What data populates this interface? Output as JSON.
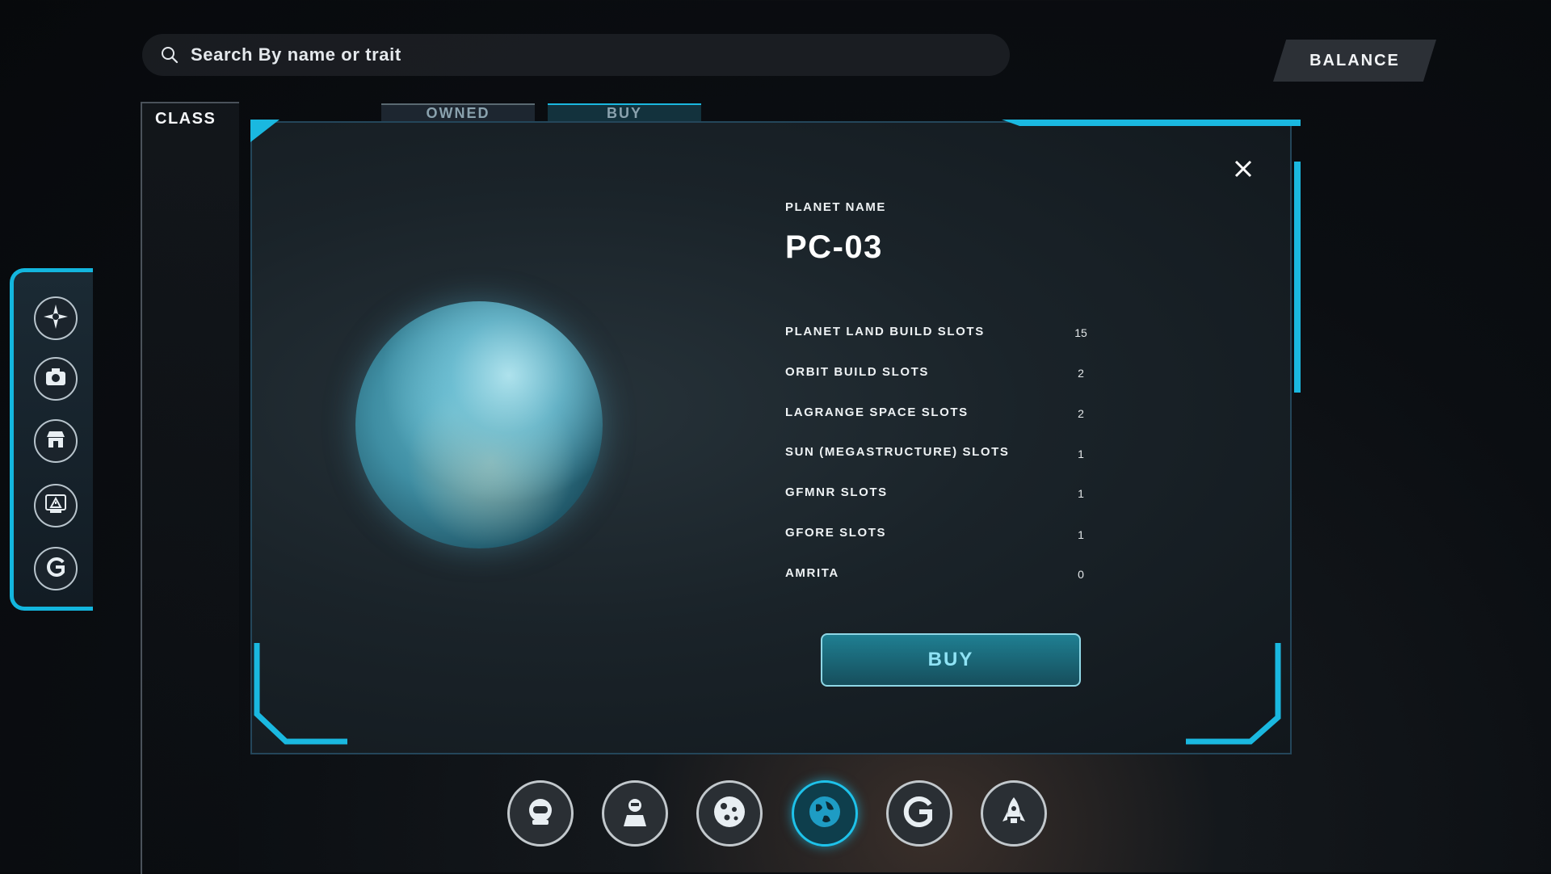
{
  "search": {
    "placeholder": "Search By name or trait",
    "icon": "search-icon"
  },
  "header": {
    "balance_label": "BALANCE"
  },
  "class_panel": {
    "label": "CLASS"
  },
  "tabs": [
    {
      "label": "OWNED",
      "active": false
    },
    {
      "label": "BUY",
      "active": true
    }
  ],
  "left_rail": {
    "items": [
      {
        "icon": "compass-icon"
      },
      {
        "icon": "camera-icon"
      },
      {
        "icon": "market-icon"
      },
      {
        "icon": "warning-icon"
      },
      {
        "icon": "g-logo-icon"
      }
    ]
  },
  "modal": {
    "close_icon": "close-icon",
    "planet_name_label": "PLANET NAME",
    "planet_name": "PC-03",
    "stats": [
      {
        "name": "PLANET LAND BUILD SLOTS",
        "value": "15"
      },
      {
        "name": "ORBIT BUILD SLOTS",
        "value": "2"
      },
      {
        "name": "LAGRANGE SPACE SLOTS",
        "value": "2"
      },
      {
        "name": "SUN (MEGASTRUCTURE) SLOTS",
        "value": "1"
      },
      {
        "name": "GFMNR SLOTS",
        "value": "1"
      },
      {
        "name": "GFORE SLOTS",
        "value": "1"
      },
      {
        "name": "AMRITA",
        "value": "0"
      }
    ],
    "buy_label": "BUY"
  },
  "bottom_nav": {
    "items": [
      {
        "icon": "astronaut-helmet-icon",
        "active": false
      },
      {
        "icon": "pilot-icon",
        "active": false
      },
      {
        "icon": "moon-icon",
        "active": false
      },
      {
        "icon": "globe-icon",
        "active": true
      },
      {
        "icon": "g-logo-icon",
        "active": false
      },
      {
        "icon": "rocket-icon",
        "active": false
      }
    ]
  },
  "colors": {
    "accent": "#1ab8e0",
    "buy_text": "#8fe3f5"
  }
}
